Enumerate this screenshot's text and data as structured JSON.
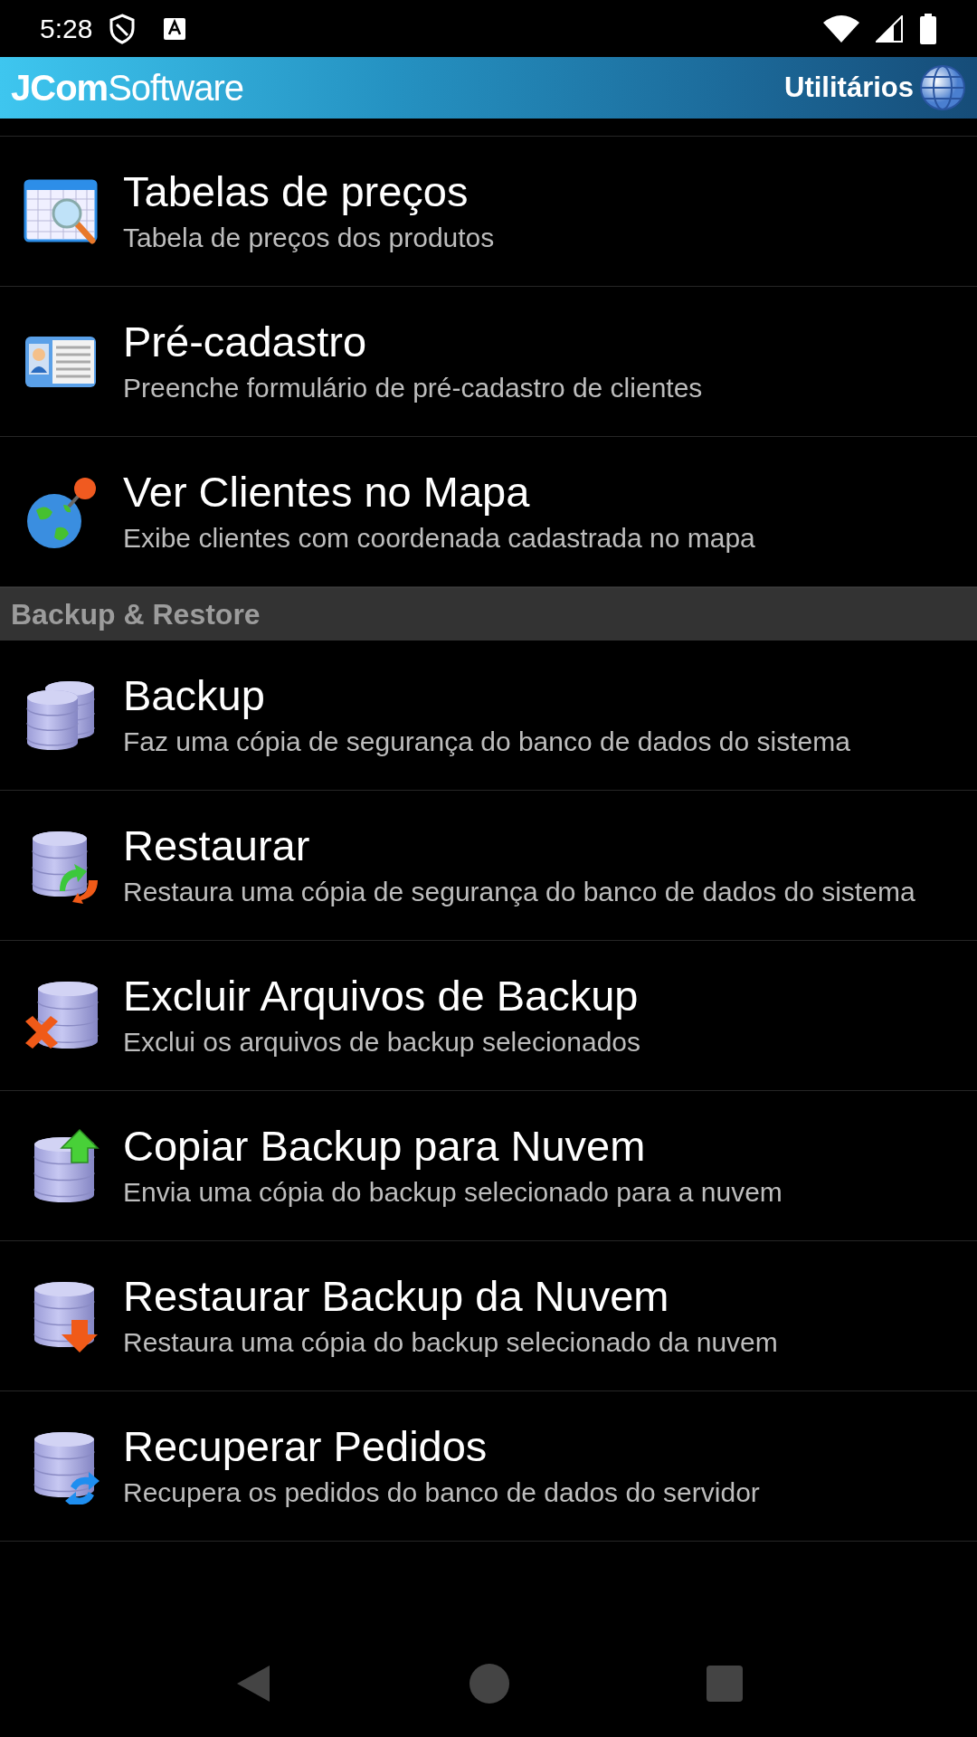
{
  "status_bar": {
    "time": "5:28"
  },
  "header": {
    "logo": "**JCom**Software",
    "title": "Utilitários"
  },
  "sections": [
    {
      "items": [
        {
          "kind": "table",
          "title": "Tabelas de preços",
          "description": "Tabela de preços dos produtos"
        },
        {
          "kind": "card",
          "title": "Pré-cadastro",
          "description": "Preenche formulário de pré-cadastro de clientes"
        },
        {
          "kind": "globe",
          "title": "Ver Clientes no Mapa",
          "description": "Exibe clientes com coordenada cadastrada no mapa"
        }
      ]
    },
    {
      "title": "Backup & Restore",
      "items": [
        {
          "kind": "databases",
          "title": "Backup",
          "description": "Faz uma cópia de segurança do banco de dados do sistema"
        },
        {
          "kind": "restore",
          "title": "Restaurar",
          "description": "Restaura uma cópia de segurança do banco de dados do sistema"
        },
        {
          "kind": "delete",
          "title": "Excluir Arquivos de Backup",
          "description": "Exclui os arquivos de backup selecionados"
        },
        {
          "kind": "upload",
          "title": "Copiar Backup para Nuvem",
          "description": "Envia uma cópia do backup selecionado para a nuvem"
        },
        {
          "kind": "download",
          "title": "Restaurar Backup da Nuvem",
          "description": "Restaura uma cópia do backup selecionado da nuvem"
        },
        {
          "kind": "sync",
          "title": "Recuperar Pedidos",
          "description": "Recupera os pedidos do banco de dados do servidor"
        }
      ]
    }
  ]
}
